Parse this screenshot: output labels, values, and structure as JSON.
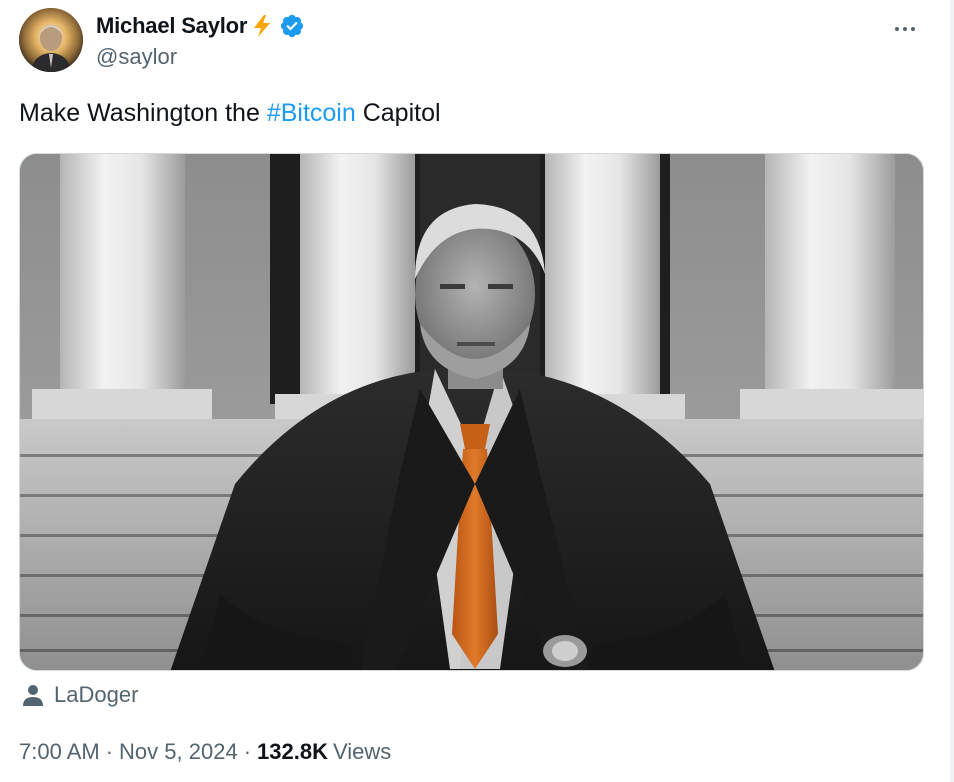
{
  "author": {
    "display_name": "Michael Saylor",
    "handle": "@saylor",
    "verified": true,
    "name_emoji": "lightning-bolt",
    "verified_color": "#1d9bf0",
    "bolt_color": "#f7a600"
  },
  "more_icon": "ellipsis-icon",
  "tweet": {
    "text_before": "Make Washington the ",
    "hashtag": "#Bitcoin",
    "text_after": " Capitol",
    "hashtag_color": "#1d9bf0"
  },
  "media": {
    "type": "photo",
    "tie_color": "#d9691a"
  },
  "media_credit": {
    "icon": "person-icon",
    "name": "LaDoger"
  },
  "meta": {
    "time": "7:00 AM",
    "separator": "·",
    "date": "Nov 5, 2024",
    "views_count": "132.8K",
    "views_label": "Views"
  }
}
